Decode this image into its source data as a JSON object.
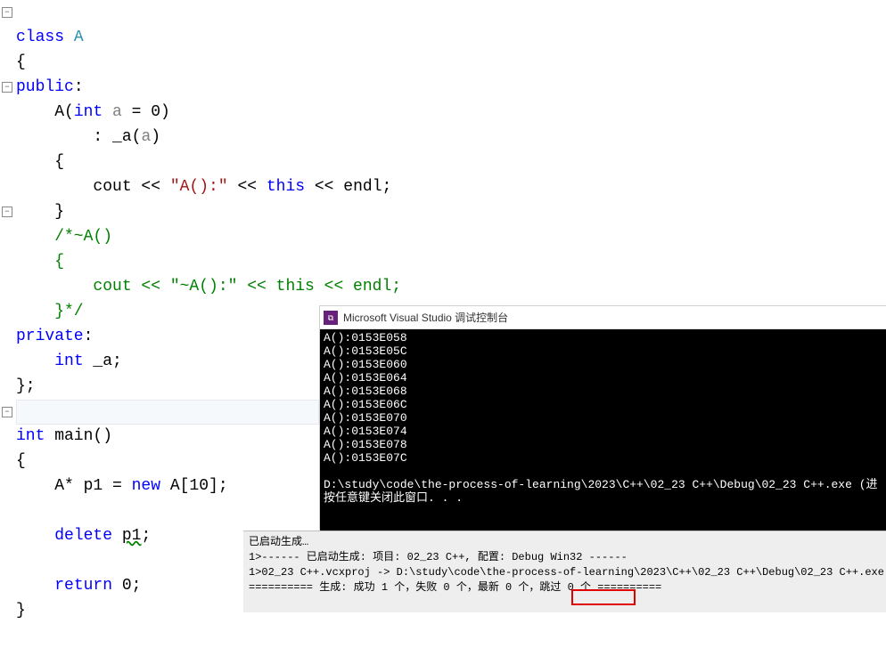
{
  "code": {
    "l1_a": "class",
    "l1_b": " A",
    "l2": "{",
    "l3": "public",
    "l3b": ":",
    "l4_a": "    A(",
    "l4_b": "int",
    "l4_c": " a = 0)",
    "l4_param": "a",
    "l5_a": "        : ",
    "l5_b": "_a",
    "l5_c": "(",
    "l5_d": "a",
    "l5_e": ")",
    "l6": "    {",
    "l7_a": "        cout << ",
    "l7_b": "\"A():\"",
    "l7_c": " << ",
    "l7_d": "this",
    "l7_e": " << endl;",
    "l8": "    }",
    "l9_a": "    /*~A()",
    "l10": "    {",
    "l11": "        cout << \"~A():\" << this << endl;",
    "l12": "    }*/",
    "l13": "private",
    "l13b": ":",
    "l14_a": "    ",
    "l14_b": "int",
    "l14_c": " _a;",
    "l15": "};",
    "l17_a": "int",
    "l17_b": " main()",
    "l18": "{",
    "l19_a": "    A* p1 = ",
    "l19_b": "new",
    "l19_c": " A[10];",
    "l21_a": "    ",
    "l21_b": "delete",
    "l21_c": " ",
    "l21_d": "p1",
    "l21_e": ";",
    "l23_a": "    ",
    "l23_b": "return",
    "l23_c": " 0;",
    "l24": "}"
  },
  "console": {
    "title": "Microsoft Visual Studio 调试控制台",
    "lines": [
      "A():0153E058",
      "A():0153E05C",
      "A():0153E060",
      "A():0153E064",
      "A():0153E068",
      "A():0153E06C",
      "A():0153E070",
      "A():0153E074",
      "A():0153E078",
      "A():0153E07C",
      "",
      "D:\\study\\code\\the-process-of-learning\\2023\\C++\\02_23 C++\\Debug\\02_23 C++.exe (进",
      "按任意键关闭此窗口. . ."
    ]
  },
  "output": {
    "l1": "已启动生成…",
    "l2": "1>------ 已启动生成: 项目: 02_23 C++, 配置: Debug Win32 ------",
    "l3": "1>02_23 C++.vcxproj -> D:\\study\\code\\the-process-of-learning\\2023\\C++\\02_23 C++\\Debug\\02_23 C++.exe",
    "l4": "========== 生成: 成功 1 个，失败 0 个，最新 0 个，跳过 0 个 =========="
  }
}
